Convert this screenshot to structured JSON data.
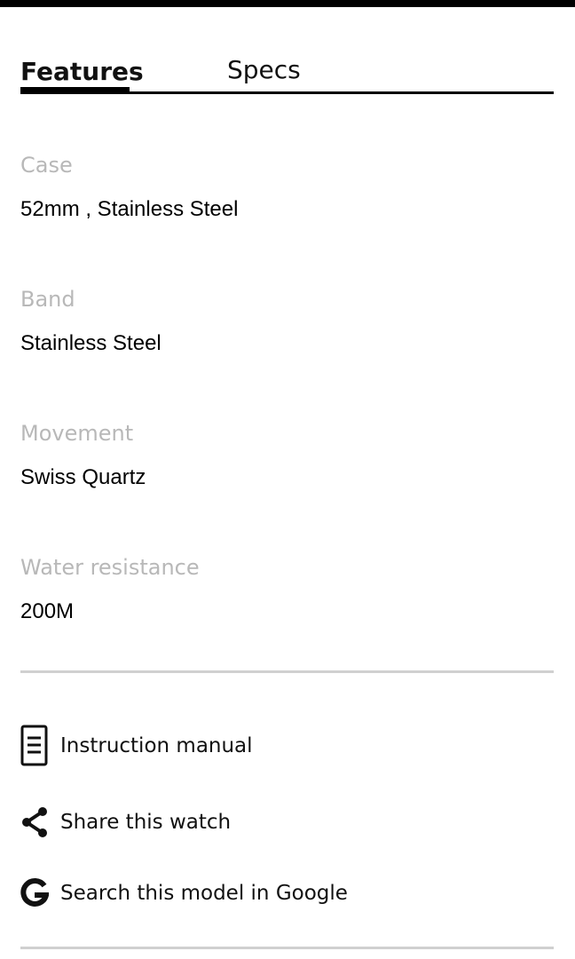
{
  "tabs": [
    {
      "label": "Features",
      "active": true
    },
    {
      "label": "Specs",
      "active": false
    }
  ],
  "specs": [
    {
      "label": "Case",
      "value": "52mm ,  Stainless Steel"
    },
    {
      "label": "Band",
      "value": "Stainless Steel"
    },
    {
      "label": "Movement",
      "value": "Swiss Quartz"
    },
    {
      "label": "Water resistance",
      "value": "200M"
    }
  ],
  "actions": [
    {
      "label": "Instruction manual",
      "icon": "document-icon"
    },
    {
      "label": "Share this watch",
      "icon": "share-icon"
    },
    {
      "label": "Search this model in Google",
      "icon": "google-icon"
    }
  ],
  "colors": {
    "accent": "#000000",
    "label_gray": "#b8b8b8",
    "divider": "#d0d0d0"
  }
}
